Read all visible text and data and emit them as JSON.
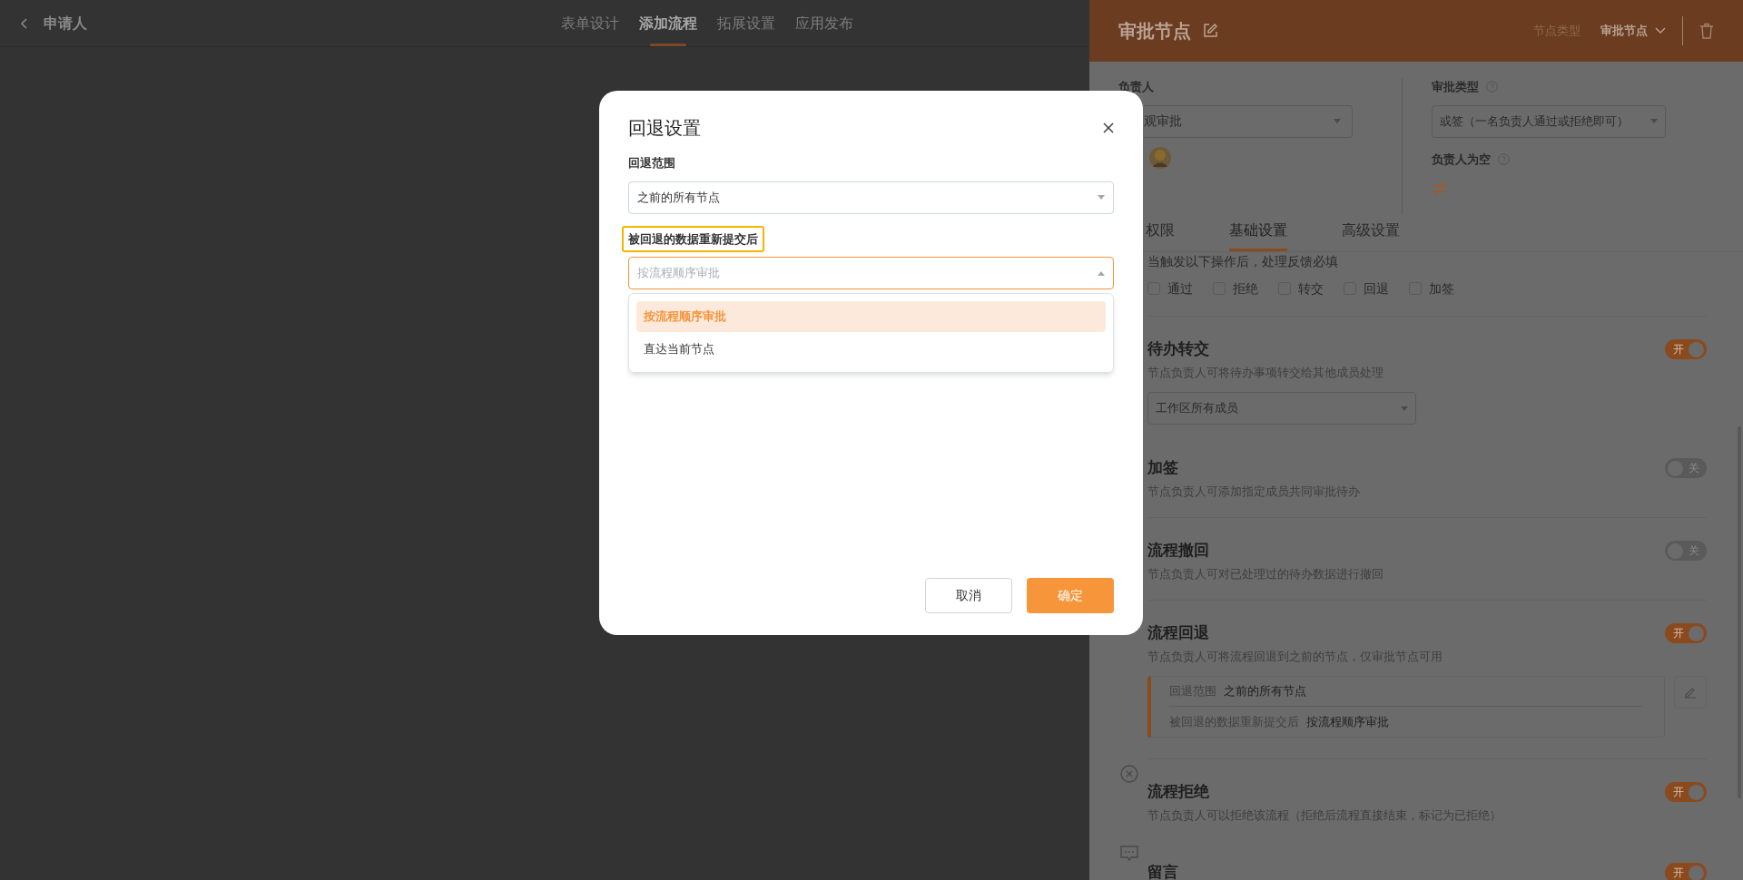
{
  "topbar": {
    "title": "申请人",
    "tabs": [
      {
        "label": "表单设计",
        "selected": false
      },
      {
        "label": "添加流程",
        "selected": true
      },
      {
        "label": "拓展设置",
        "selected": false
      },
      {
        "label": "应用发布",
        "selected": false
      }
    ]
  },
  "panel": {
    "title": "审批节点",
    "node_type_label": "节点类型",
    "node_type_value": "审批节点",
    "owner": {
      "label": "负责人",
      "value": "观审批"
    },
    "approval_type": {
      "label": "审批类型",
      "value": "或签（一名负责人通过或拒绝即可）"
    },
    "empty_owner": {
      "label": "负责人为空"
    },
    "tabs": [
      {
        "label": "权限",
        "selected": false
      },
      {
        "label": "基础设置",
        "selected": true
      },
      {
        "label": "高级设置",
        "selected": false
      }
    ],
    "feedback": {
      "label": "当触发以下操作后，处理反馈必填",
      "options": [
        {
          "label": "通过",
          "checked": false
        },
        {
          "label": "拒绝",
          "checked": false
        },
        {
          "label": "转交",
          "checked": false
        },
        {
          "label": "回退",
          "checked": false
        },
        {
          "label": "加签",
          "checked": false
        }
      ]
    },
    "settings": [
      {
        "kind": "select",
        "title": "待办转交",
        "description": "节点负责人可将待办事项转交给其他成员处理",
        "on": true,
        "toggle_label": "开",
        "value": "工作区所有成员"
      },
      {
        "kind": "plain",
        "title": "加签",
        "description": "节点负责人可添加指定成员共同审批待办",
        "on": false,
        "toggle_label": "关"
      },
      {
        "kind": "plain",
        "title": "流程撤回",
        "description": "节点负责人可对已处理过的待办数据进行撤回",
        "on": false,
        "toggle_label": "关"
      },
      {
        "kind": "rollback",
        "title": "流程回退",
        "description": "节点负责人可将流程回退到之前的节点，仅审批节点可用",
        "on": true,
        "toggle_label": "开",
        "rows": [
          {
            "label": "回退范围",
            "value": "之前的所有节点"
          },
          {
            "label": "被回退的数据重新提交后",
            "value": "按流程顺序审批"
          }
        ]
      },
      {
        "kind": "reject",
        "title": "流程拒绝",
        "description": "节点负责人可以拒绝该流程（拒绝后流程直接结束，标记为已拒绝）",
        "on": true,
        "toggle_label": "开"
      },
      {
        "kind": "comment",
        "title": "留言",
        "on": true,
        "toggle_label": "开"
      }
    ]
  },
  "dialog": {
    "title": "回退设置",
    "range_label": "回退范围",
    "range_value": "之前的所有节点",
    "resubmit_label": "被回退的数据重新提交后",
    "resubmit_placeholder": "按流程顺序审批",
    "options": [
      {
        "label": "按流程顺序审批",
        "selected": true
      },
      {
        "label": "直达当前节点",
        "selected": false
      }
    ],
    "buttons": [
      {
        "kind": "secondary",
        "label": "取消"
      },
      {
        "kind": "primary",
        "label": "确定"
      }
    ]
  }
}
